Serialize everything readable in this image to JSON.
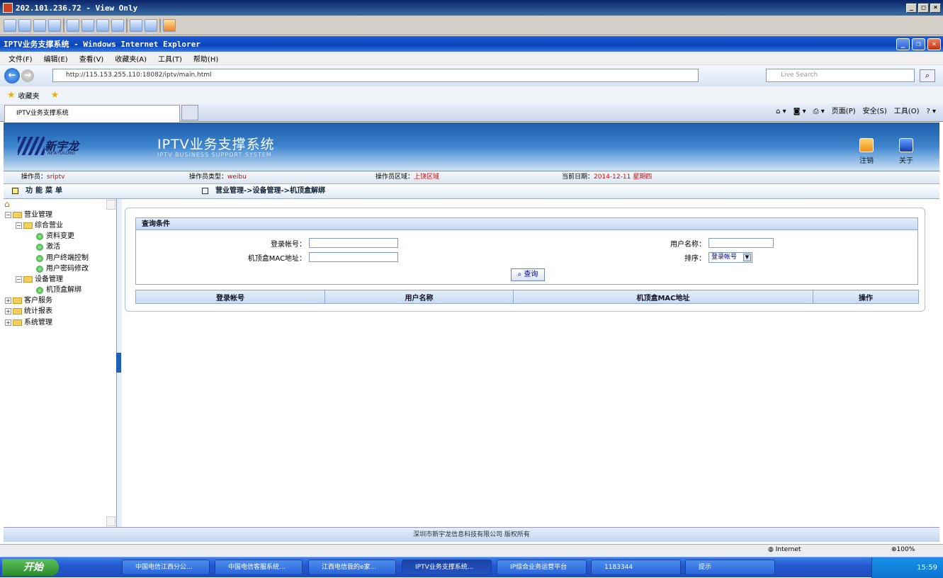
{
  "vnc": {
    "title": "202.101.236.72 - View Only"
  },
  "ie": {
    "title": "IPTV业务支撑系统 - Windows Internet Explorer",
    "menu": [
      "文件(F)",
      "编辑(E)",
      "查看(V)",
      "收藏夹(A)",
      "工具(T)",
      "帮助(H)"
    ],
    "address": "http://115.153.255.110:18082/iptv/main.html",
    "search_placeholder": "Live Search",
    "favorites_label": "收藏夹",
    "tab_title": "IPTV业务支撑系统",
    "cmd": {
      "page": "页面(P)",
      "safety": "安全(S)",
      "tools": "工具(O)"
    },
    "status_zone": "Internet",
    "zoom": "100%"
  },
  "app": {
    "logo_text": "新宇龙",
    "logo_sub": "NEWYULONG",
    "title": "IPTV业务支撑系统",
    "subtitle": "IPTV BUSINESS SUPPORT SYSTEM",
    "logout_label": "注销",
    "about_label": "关于",
    "info": {
      "operator_label": "操作员：",
      "operator": "sriptv",
      "type_label": "操作员类型：",
      "type": "weibu",
      "region_label": "操作员区域：",
      "region": "上饶区域",
      "date_label": "当前日期：",
      "date": "2014-12-11",
      "weekday": "星期四"
    },
    "menu_title": "功能菜单",
    "breadcrumb": "营业管理->设备管理->机顶盒解绑",
    "tree": {
      "business": "营业管理",
      "integrated": "综合营业",
      "profile_change": "资料变更",
      "activate": "激活",
      "terminal_control": "用户终端控制",
      "password_change": "用户密码修改",
      "device_mgmt": "设备管理",
      "stb_unbind": "机顶盒解绑",
      "customer_service": "客户服务",
      "reports": "统计报表",
      "system_mgmt": "系统管理"
    },
    "query": {
      "header": "查询条件",
      "login_label": "登录帐号：",
      "username_label": "用户名称：",
      "mac_label": "机顶盒MAC地址：",
      "sort_label": "排序：",
      "sort_value": "登录帐号",
      "query_button": "查询"
    },
    "columns": [
      "登录帐号",
      "用户名称",
      "机顶盒MAC地址",
      "操作"
    ],
    "footer": "深圳市新宇龙信息科技有限公司 版权所有"
  },
  "taskbar": {
    "start": "开始",
    "items": [
      "中国电信江西分公...",
      "中国电信客服系统...",
      "江西电信我的e家...",
      "IPTV业务支撑系统...",
      "IP综合业务运营平台",
      "1183344",
      "提示"
    ],
    "clock": "15:59"
  }
}
